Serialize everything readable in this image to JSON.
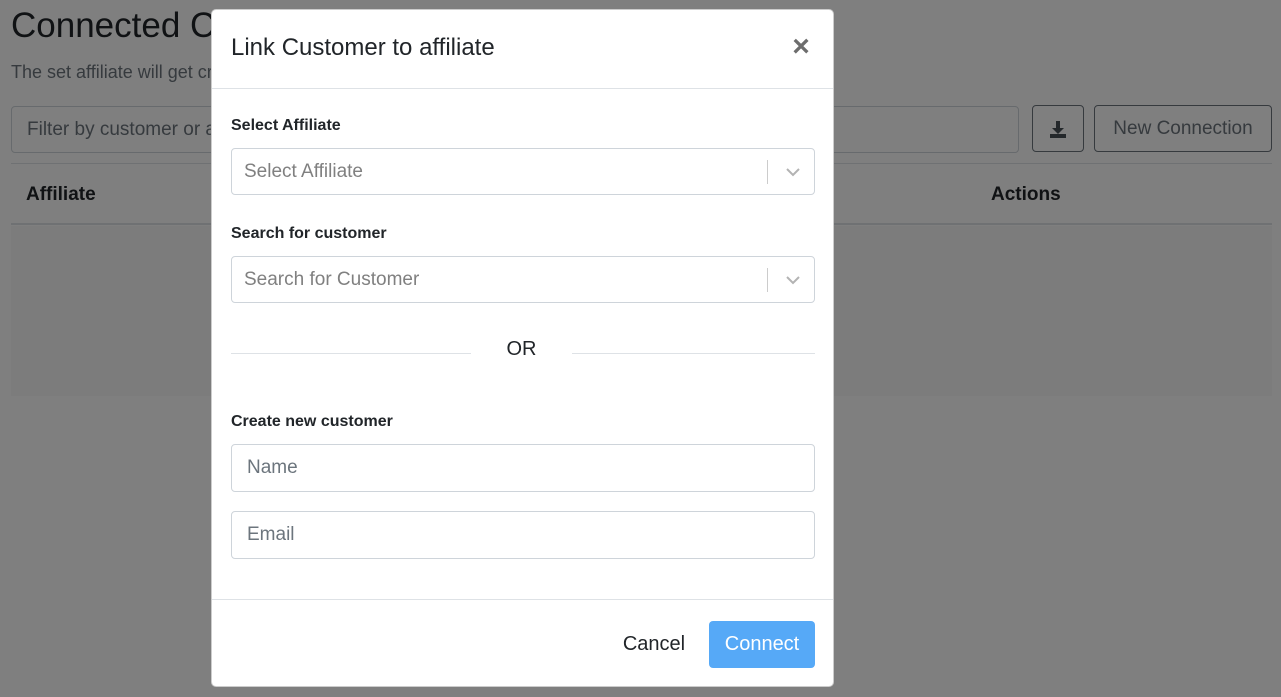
{
  "page": {
    "title": "Connected Customers",
    "subtitle": "The set affiliate will get credit for all purchases made by the connected customer.",
    "filter_placeholder": "Filter by customer or affiliate",
    "new_connection_label": "New Connection",
    "download_icon": "download-icon",
    "table": {
      "columns": [
        "Affiliate",
        "Actions"
      ]
    }
  },
  "modal": {
    "title": "Link Customer to affiliate",
    "close_label": "×",
    "select_affiliate": {
      "label": "Select Affiliate",
      "placeholder": "Select Affiliate"
    },
    "search_customer": {
      "label": "Search for customer",
      "placeholder": "Search for Customer"
    },
    "divider_text": "OR",
    "create_customer": {
      "label": "Create new customer",
      "name_placeholder": "Name",
      "email_placeholder": "Email"
    },
    "footer": {
      "cancel_label": "Cancel",
      "connect_label": "Connect"
    }
  },
  "colors": {
    "primary": "#56a9f7",
    "backdrop": "rgba(0,0,0,0.5)"
  }
}
